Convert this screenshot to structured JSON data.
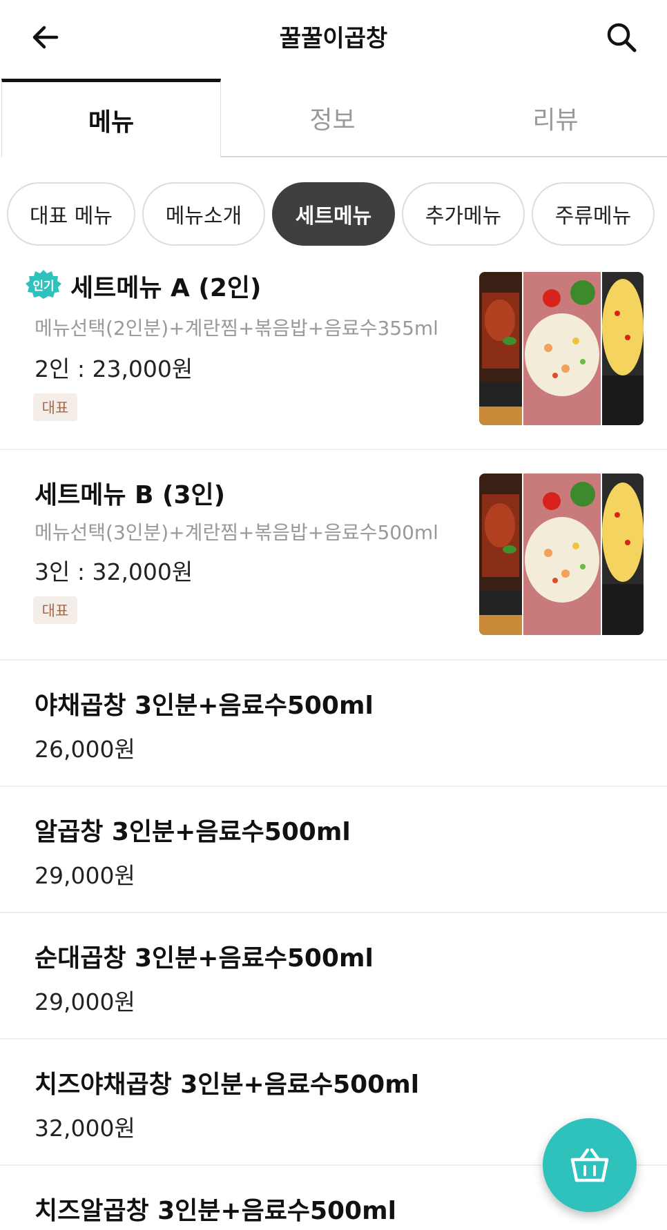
{
  "header": {
    "title": "꿀꿀이곱창"
  },
  "tabs": [
    {
      "label": "메뉴"
    },
    {
      "label": "정보"
    },
    {
      "label": "리뷰"
    }
  ],
  "chips": [
    {
      "label": "대표 메뉴"
    },
    {
      "label": "메뉴소개"
    },
    {
      "label": "세트메뉴"
    },
    {
      "label": "추가메뉴"
    },
    {
      "label": "주류메뉴"
    }
  ],
  "active_chip": "세트메뉴",
  "menu": [
    {
      "name": "세트메뉴 A (2인)",
      "badge": "인기",
      "desc": "메뉴선택(2인분)+계란찜+볶음밥+음료수355ml",
      "price": "2인 : 23,000원",
      "tag": "대표"
    },
    {
      "name": "세트메뉴 B (3인)",
      "desc": "메뉴선택(3인분)+계란찜+볶음밥+음료수500ml",
      "price": "3인 : 32,000원",
      "tag": "대표"
    },
    {
      "name": "야채곱창 3인분+음료수500ml",
      "price": "26,000원"
    },
    {
      "name": "알곱창 3인분+음료수500ml",
      "price": "29,000원"
    },
    {
      "name": "순대곱창 3인분+음료수500ml",
      "price": "29,000원"
    },
    {
      "name": "치즈야채곱창 3인분+음료수500ml",
      "price": "32,000원"
    },
    {
      "name": "치즈알곱창 3인분+음료수500ml"
    }
  ],
  "colors": {
    "accent": "#2fc2bd",
    "active_chip_bg": "#3f3f3f",
    "tag_text": "#a06a4a"
  },
  "icons": {
    "back": "arrow-left-icon",
    "search": "search-icon",
    "cart": "basket-icon"
  }
}
